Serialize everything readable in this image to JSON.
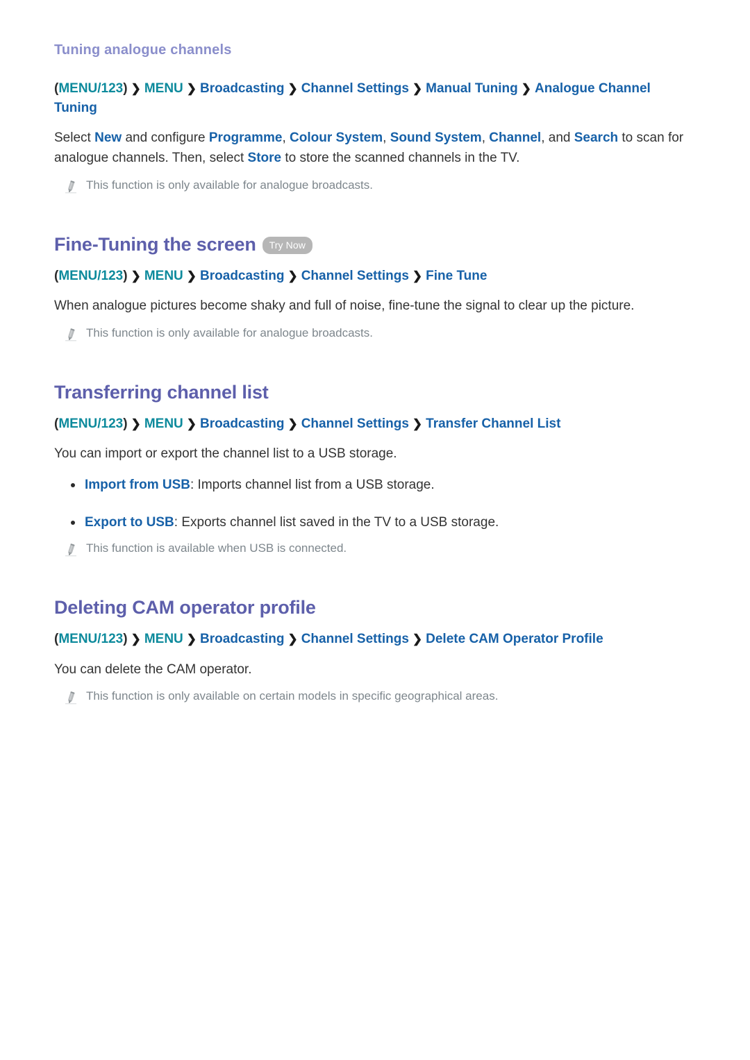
{
  "page": {
    "background": "#ffffff",
    "accent_heading": "#5d5fab",
    "accent_subheading": "#8a8ecb",
    "accent_keyword": "#1761a8",
    "accent_menu_key": "#0d8a9c",
    "note_color": "#7d868c",
    "badge_bg": "#b6b6b6"
  },
  "icons": {
    "note": "pencil-icon",
    "separator": "❯",
    "bullet": "•"
  },
  "sections": [
    {
      "id": "tuning-analogue-channels",
      "level": "sub",
      "title": "Tuning analogue channels",
      "badge": null,
      "breadcrumb": {
        "open_paren": "(",
        "close_paren": ")",
        "key": "MENU/123",
        "items": [
          "MENU",
          "Broadcasting",
          "Channel Settings",
          "Manual Tuning",
          "Analogue Channel Tuning"
        ]
      },
      "paragraphs": [
        {
          "runs": [
            {
              "t": "Select ",
              "k": false
            },
            {
              "t": "New",
              "k": true
            },
            {
              "t": " and configure ",
              "k": false
            },
            {
              "t": "Programme",
              "k": true
            },
            {
              "t": ", ",
              "k": false
            },
            {
              "t": "Colour System",
              "k": true
            },
            {
              "t": ", ",
              "k": false
            },
            {
              "t": "Sound System",
              "k": true
            },
            {
              "t": ", ",
              "k": false
            },
            {
              "t": "Channel",
              "k": true
            },
            {
              "t": ", and ",
              "k": false
            },
            {
              "t": "Search",
              "k": true
            },
            {
              "t": " to scan for analogue channels. Then, select ",
              "k": false
            },
            {
              "t": "Store",
              "k": true
            },
            {
              "t": " to store the scanned channels in the TV.",
              "k": false
            }
          ]
        }
      ],
      "bullets": [],
      "notes": [
        "This function is only available for analogue broadcasts."
      ]
    },
    {
      "id": "fine-tuning-the-screen",
      "level": "main",
      "title": "Fine-Tuning the screen",
      "badge": "Try Now",
      "breadcrumb": {
        "open_paren": "(",
        "close_paren": ")",
        "key": "MENU/123",
        "items": [
          "MENU",
          "Broadcasting",
          "Channel Settings",
          "Fine Tune"
        ]
      },
      "paragraphs": [
        {
          "runs": [
            {
              "t": "When analogue pictures become shaky and full of noise, fine-tune the signal to clear up the picture.",
              "k": false
            }
          ]
        }
      ],
      "bullets": [],
      "notes": [
        "This function is only available for analogue broadcasts."
      ]
    },
    {
      "id": "transferring-channel-list",
      "level": "main",
      "title": "Transferring channel list",
      "badge": null,
      "breadcrumb": {
        "open_paren": "(",
        "close_paren": ")",
        "key": "MENU/123",
        "items": [
          "MENU",
          "Broadcasting",
          "Channel Settings",
          "Transfer Channel List"
        ]
      },
      "paragraphs": [
        {
          "runs": [
            {
              "t": "You can import or export the channel list to a USB storage.",
              "k": false
            }
          ]
        }
      ],
      "bullets": [
        {
          "runs": [
            {
              "t": "Import from USB",
              "k": true
            },
            {
              "t": ": Imports channel list from a USB storage.",
              "k": false
            }
          ]
        },
        {
          "runs": [
            {
              "t": "Export to USB",
              "k": true
            },
            {
              "t": ": Exports channel list saved in the TV to a USB storage.",
              "k": false
            }
          ]
        }
      ],
      "notes": [
        "This function is available when USB is connected."
      ]
    },
    {
      "id": "deleting-cam-operator-profile",
      "level": "main",
      "title": "Deleting CAM operator profile",
      "badge": null,
      "breadcrumb": {
        "open_paren": "(",
        "close_paren": ")",
        "key": "MENU/123",
        "items": [
          "MENU",
          "Broadcasting",
          "Channel Settings",
          "Delete CAM Operator Profile"
        ]
      },
      "paragraphs": [
        {
          "runs": [
            {
              "t": "You can delete the CAM operator.",
              "k": false
            }
          ]
        }
      ],
      "bullets": [],
      "notes": [
        "This function is only available on certain models in specific geographical areas."
      ]
    }
  ]
}
